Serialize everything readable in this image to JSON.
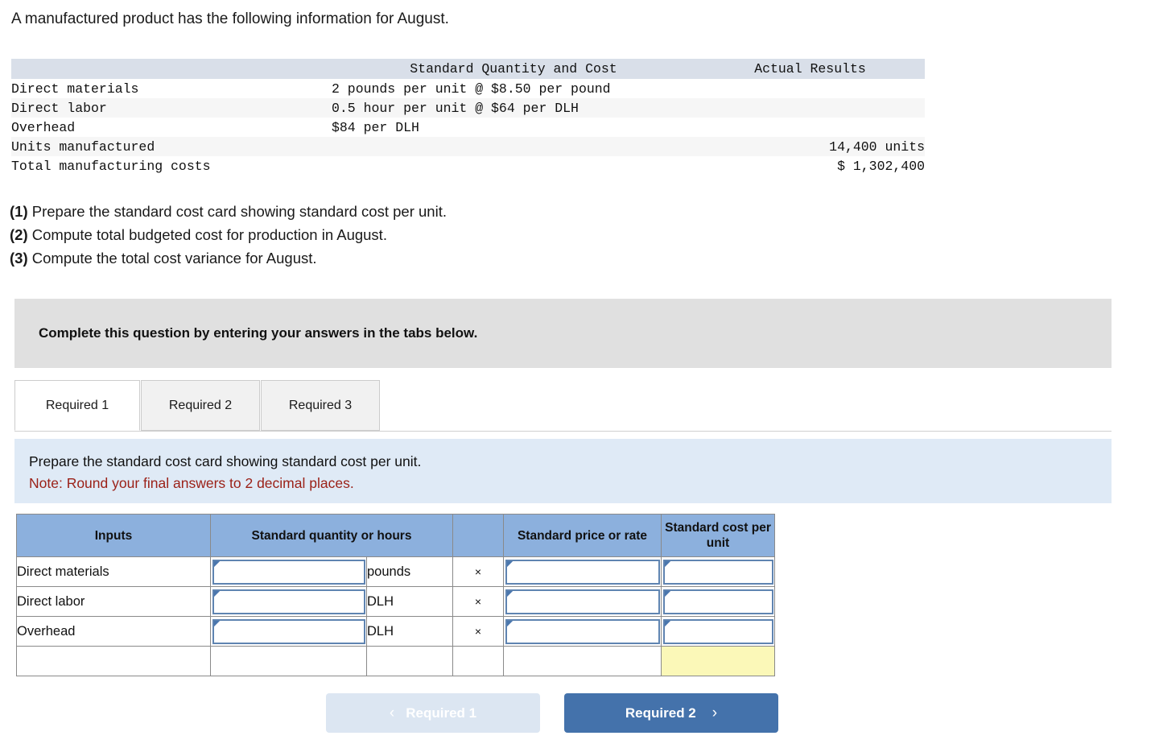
{
  "intro": "A manufactured product has the following information for August.",
  "info_table": {
    "headers": [
      "",
      "Standard Quantity and Cost",
      "Actual Results"
    ],
    "rows": [
      {
        "label": "Direct materials",
        "standard": "2 pounds per unit @ $8.50 per pound",
        "actual": ""
      },
      {
        "label": "Direct labor",
        "standard": "0.5 hour per unit @ $64 per DLH",
        "actual": ""
      },
      {
        "label": "Overhead",
        "standard": "$84 per DLH",
        "actual": ""
      },
      {
        "label": "Units manufactured",
        "standard": "",
        "actual": "14,400 units"
      },
      {
        "label": "Total manufacturing costs",
        "standard": "",
        "actual": "$ 1,302,400"
      }
    ]
  },
  "requirements": [
    {
      "num": "(1)",
      "text": " Prepare the standard cost card showing standard cost per unit."
    },
    {
      "num": "(2)",
      "text": " Compute total budgeted cost for production in August."
    },
    {
      "num": "(3)",
      "text": " Compute the total cost variance for August."
    }
  ],
  "banner": {
    "text": "Complete this question by entering your answers in the tabs below."
  },
  "tabs": [
    {
      "label": "Required 1",
      "active": true
    },
    {
      "label": "Required 2",
      "active": false
    },
    {
      "label": "Required 3",
      "active": false
    }
  ],
  "instruction": {
    "line1": "Prepare the standard cost card showing standard cost per unit.",
    "note": "Note: Round your final answers to 2 decimal places."
  },
  "answer_table": {
    "headers": {
      "inputs": "Inputs",
      "quantity": "Standard quantity or hours",
      "blank": "",
      "rate": "Standard price or rate",
      "cost": "Standard cost per unit"
    },
    "rows": [
      {
        "label": "Direct materials",
        "qty_value": "",
        "unit": "pounds",
        "operator": "×",
        "rate_value": "",
        "cost_value": ""
      },
      {
        "label": "Direct labor",
        "qty_value": "",
        "unit": "DLH",
        "operator": "×",
        "rate_value": "",
        "cost_value": ""
      },
      {
        "label": "Overhead",
        "qty_value": "",
        "unit": "DLH",
        "operator": "×",
        "rate_value": "",
        "cost_value": ""
      }
    ],
    "total_row": {
      "label": "",
      "qty_value": "",
      "unit": "",
      "operator": "",
      "rate_value": "",
      "total_value": ""
    }
  },
  "navigation": {
    "prev_label": "Required 1",
    "prev_chevron": "‹",
    "next_label": "Required 2",
    "next_chevron": "›"
  },
  "colors": {
    "header_blue": "#8cb0dd",
    "info_header": "#d9dfe9",
    "banner_gray": "#e0e0e0",
    "panel_blue": "#dfeaf6",
    "note_red": "#9b2118",
    "input_border": "#5f84b1",
    "total_yellow": "#fbf8b8",
    "button_blue": "#4472ab",
    "button_disabled": "#dce6f2"
  }
}
